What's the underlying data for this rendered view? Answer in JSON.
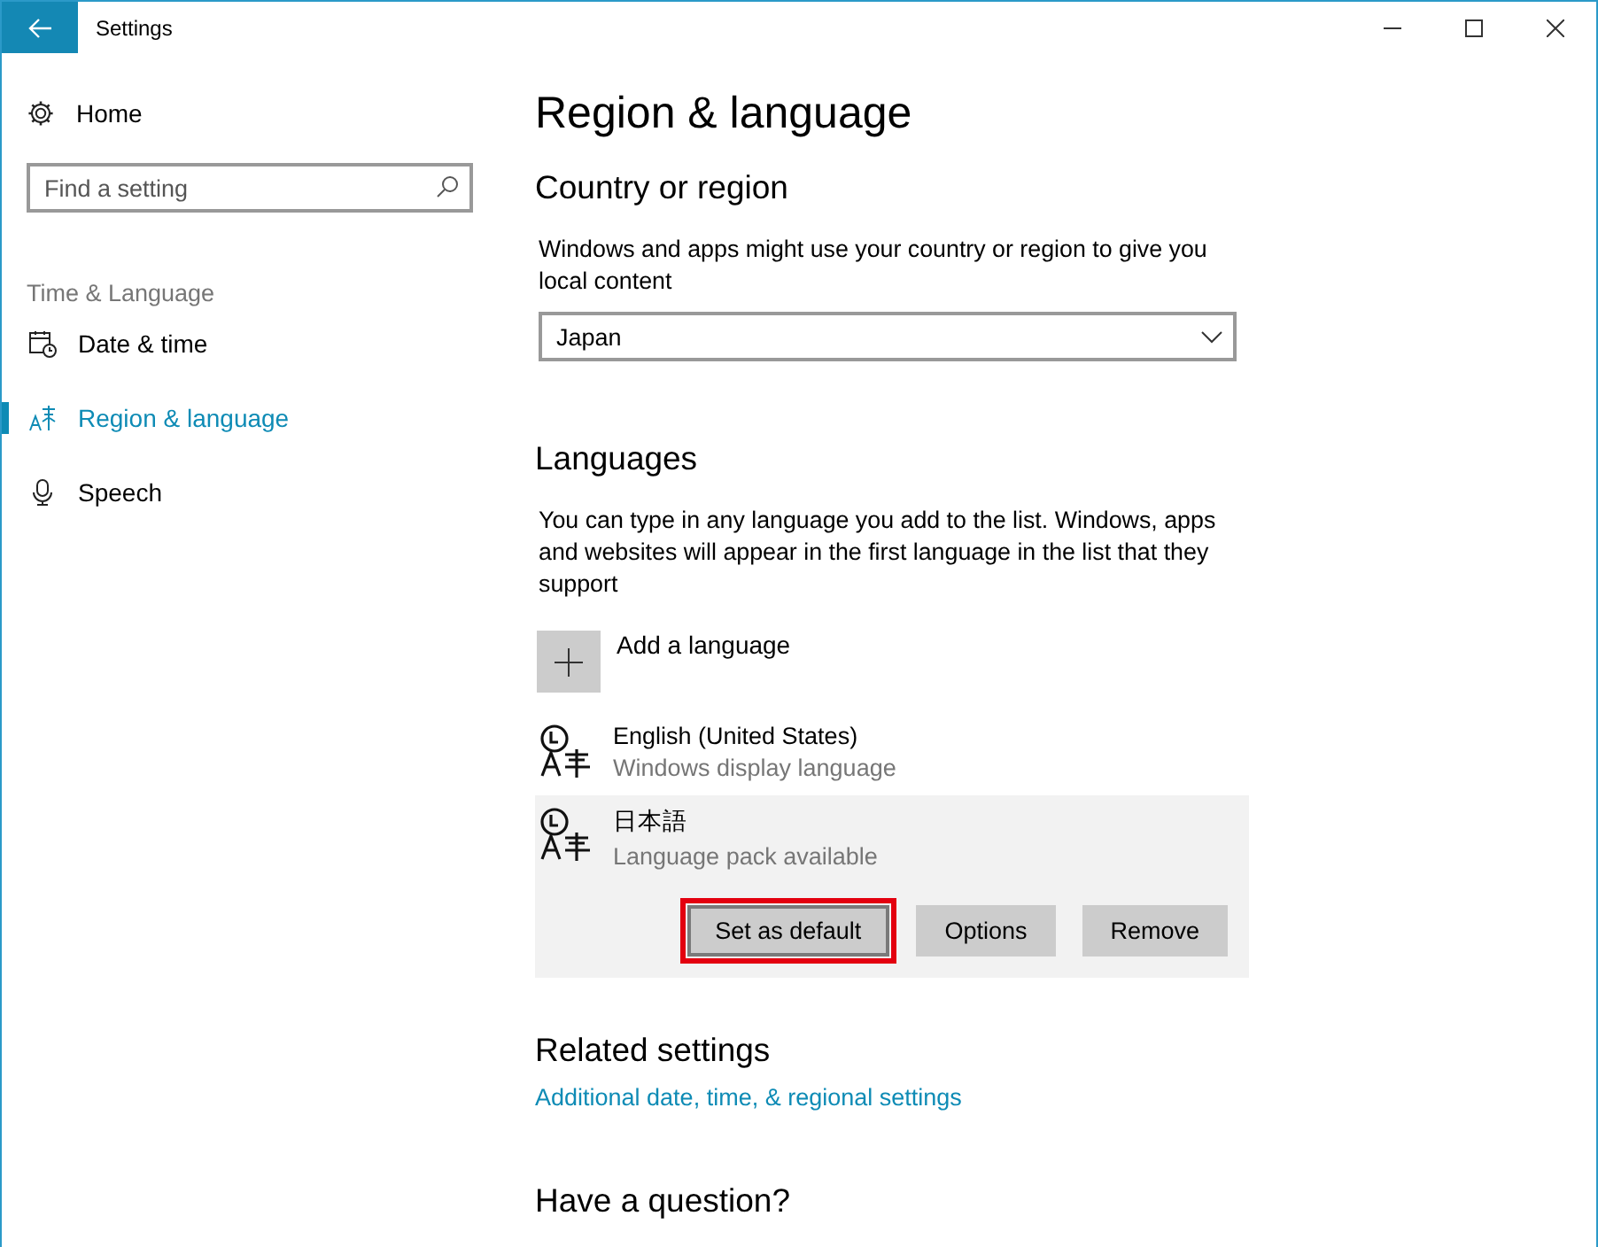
{
  "window": {
    "title": "Settings"
  },
  "sidebar": {
    "home": "Home",
    "search": {
      "placeholder": "Find a setting"
    },
    "section": "Time & Language",
    "items": [
      {
        "label": "Date & time",
        "kind": "calendar",
        "selected": false
      },
      {
        "label": "Region & language",
        "kind": "region",
        "selected": true
      },
      {
        "label": "Speech",
        "kind": "mic",
        "selected": false
      }
    ]
  },
  "page": {
    "title": "Region & language",
    "country": {
      "heading": "Country or region",
      "description": "Windows and apps might use your country or region to give you local content",
      "dropdown": {
        "value": "Japan"
      }
    },
    "languages": {
      "heading": "Languages",
      "description": "You can type in any language you add to the list. Windows, apps and websites will appear in the first language in the list that they support",
      "add": "Add a language",
      "items": [
        {
          "name": "English (United States)",
          "status": "Windows display language",
          "selected": false
        },
        {
          "name": "日本語",
          "status": "Language pack available",
          "selected": true
        }
      ],
      "actions": [
        {
          "label": "Set as default",
          "highlighted": true
        },
        {
          "label": "Options",
          "highlighted": false
        },
        {
          "label": "Remove",
          "highlighted": false
        }
      ]
    },
    "related": {
      "heading": "Related settings",
      "link": "Additional date, time, & regional settings"
    },
    "question": {
      "heading": "Have a question?"
    }
  }
}
